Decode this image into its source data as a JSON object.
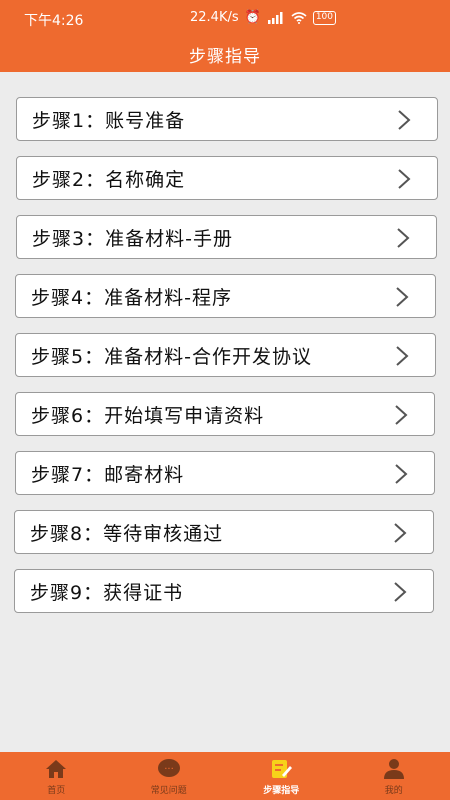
{
  "status_bar": {
    "time": "下午4:26",
    "speed": "22.4K/s",
    "battery": "100"
  },
  "header": {
    "title": "步骤指导"
  },
  "steps": [
    {
      "label": "步骤1：账号准备"
    },
    {
      "label": "步骤2：名称确定"
    },
    {
      "label": "步骤3：准备材料-手册"
    },
    {
      "label": "步骤4：准备材料-程序"
    },
    {
      "label": "步骤5：准备材料-合作开发协议"
    },
    {
      "label": "步骤6：开始填写申请资料"
    },
    {
      "label": "步骤7：邮寄材料"
    },
    {
      "label": "步骤8：等待审核通过"
    },
    {
      "label": "步骤9：获得证书"
    }
  ],
  "tabbar": {
    "tabs": [
      {
        "label": "首页",
        "icon": "home-icon"
      },
      {
        "label": "常见问题",
        "icon": "faq-icon"
      },
      {
        "label": "步骤指导",
        "icon": "edit-note-icon",
        "active": true
      },
      {
        "label": "我的",
        "icon": "user-icon"
      }
    ]
  },
  "colors": {
    "accent": "#ee6a2f",
    "background": "#ececec"
  }
}
